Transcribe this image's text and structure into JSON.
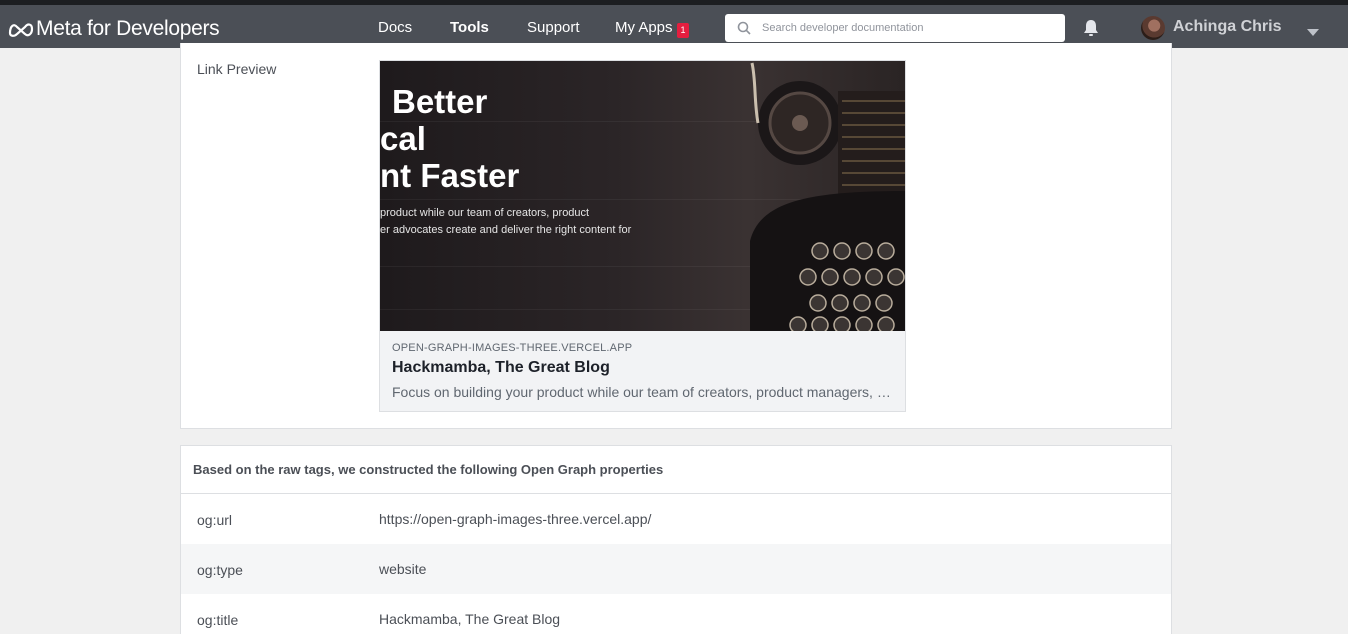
{
  "header": {
    "logo_text": "Meta for Developers",
    "nav": [
      "Docs",
      "Tools",
      "Support",
      "My Apps"
    ],
    "apps_badge": "1",
    "search_placeholder": "Search developer documentation",
    "user_name": "Achinga Chris"
  },
  "preview": {
    "label": "Link Preview",
    "image_text": {
      "line1": "Better",
      "line2": "cal",
      "line3": "nt Faster",
      "body1": "product while our team of creators, product",
      "body2": "er advocates create and deliver the right content for"
    },
    "domain": "OPEN-GRAPH-IMAGES-THREE.VERCEL.APP",
    "title": "Hackmamba, The Great Blog",
    "description": "Focus on building your product while our team of creators, product managers, product managers, and developer advocates create and deliver the right content for"
  },
  "properties": {
    "heading": "Based on the raw tags, we constructed the following Open Graph properties",
    "rows": [
      {
        "key": "og:url",
        "value": "https://open-graph-images-three.vercel.app/"
      },
      {
        "key": "og:type",
        "value": "website"
      },
      {
        "key": "og:title",
        "value": "Hackmamba, The Great Blog"
      }
    ]
  },
  "colors": {
    "topbar": "#4b4f56",
    "badge": "#e41e3f",
    "panel_border": "#dddfe2"
  },
  "icons": [
    "meta-logo-icon",
    "search-icon",
    "bell-icon",
    "chevron-down-icon"
  ]
}
